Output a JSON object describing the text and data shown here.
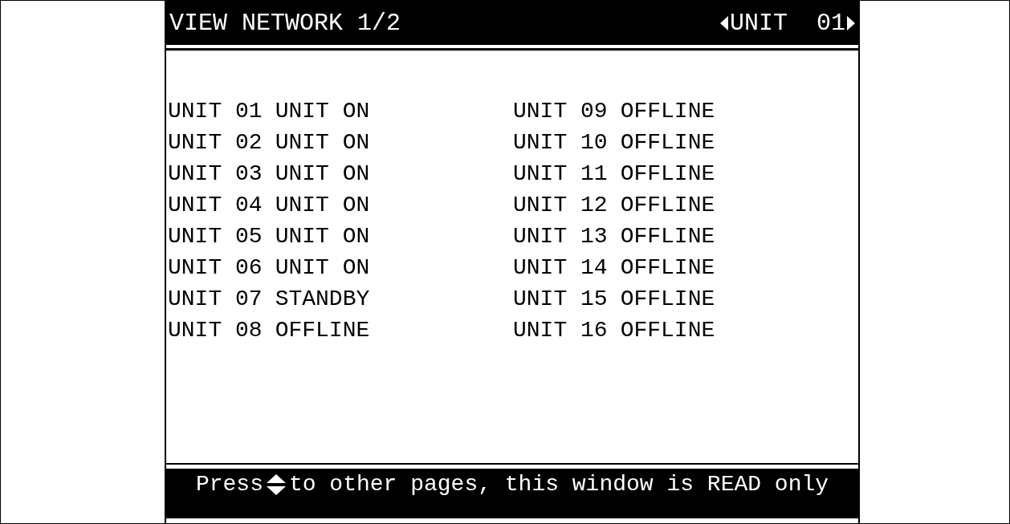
{
  "title_bar": {
    "title": "VIEW NETWORK 1/2",
    "unit_selector": "UNIT  01"
  },
  "columns": [
    [
      {
        "unit": "UNIT 01",
        "status": "UNIT ON"
      },
      {
        "unit": "UNIT 02",
        "status": "UNIT ON"
      },
      {
        "unit": "UNIT 03",
        "status": "UNIT ON"
      },
      {
        "unit": "UNIT 04",
        "status": "UNIT ON"
      },
      {
        "unit": "UNIT 05",
        "status": "UNIT ON"
      },
      {
        "unit": "UNIT 06",
        "status": "UNIT ON"
      },
      {
        "unit": "UNIT 07",
        "status": "STANDBY"
      },
      {
        "unit": "UNIT 08",
        "status": "OFFLINE"
      }
    ],
    [
      {
        "unit": "UNIT 09",
        "status": "OFFLINE"
      },
      {
        "unit": "UNIT 10",
        "status": "OFFLINE"
      },
      {
        "unit": "UNIT 11",
        "status": "OFFLINE"
      },
      {
        "unit": "UNIT 12",
        "status": "OFFLINE"
      },
      {
        "unit": "UNIT 13",
        "status": "OFFLINE"
      },
      {
        "unit": "UNIT 14",
        "status": "OFFLINE"
      },
      {
        "unit": "UNIT 15",
        "status": "OFFLINE"
      },
      {
        "unit": "UNIT 16",
        "status": "OFFLINE"
      }
    ]
  ],
  "footer": {
    "before_icon": "Press",
    "after_icon": "to other pages, this window is READ only"
  }
}
